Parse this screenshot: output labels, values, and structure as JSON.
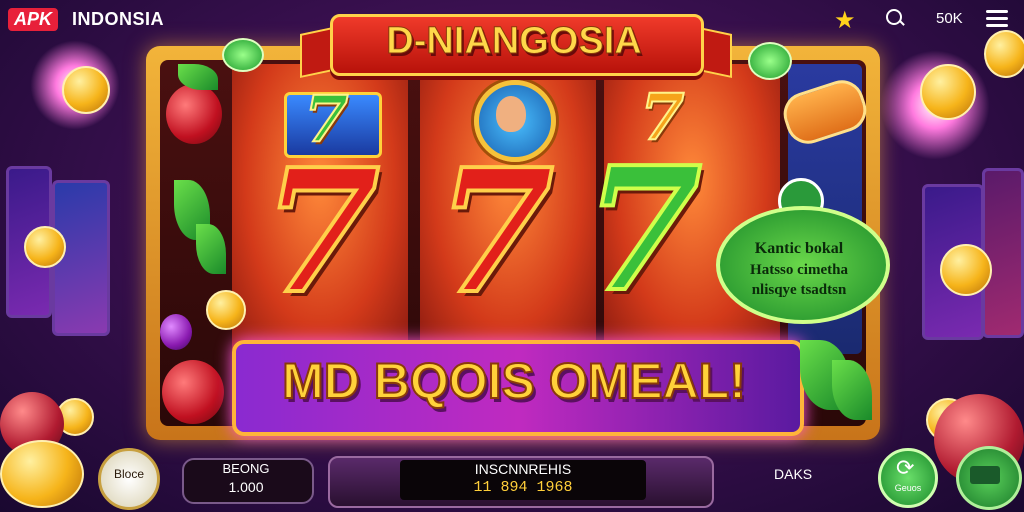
{
  "header": {
    "logo_badge": "APK",
    "logo_text": "INDONSIA",
    "coins": "50K"
  },
  "game": {
    "title": "D-NIANGOSIA",
    "promo_text": "MD BQOIS OMEAL!",
    "badge_text": "Kantic bokal",
    "badge_lines": [
      "Hatsso cimetha",
      "nlisqye tsadtsn"
    ],
    "bottom_left_label": "Bloce",
    "spin_label": "Geuos"
  },
  "controls": {
    "bet_label": "BEONG",
    "bet_value": "1.000",
    "win_label": "INSCNNREHIS",
    "win_value": "11 894 1968",
    "daks_label": "DAKS"
  },
  "colors": {
    "primary_red": "#e2201a",
    "gold": "#ffd23a",
    "green": "#3ac03a",
    "purple": "#8a2ad0"
  }
}
